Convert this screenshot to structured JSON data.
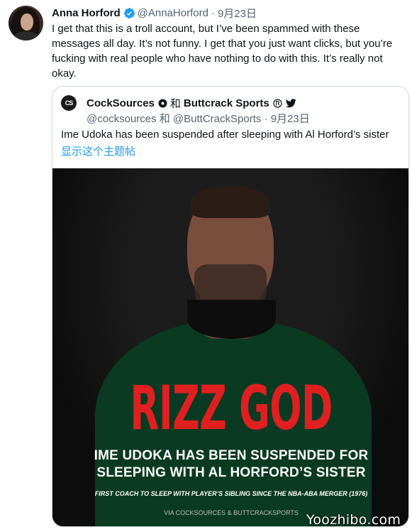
{
  "tweet": {
    "author_name": "Anna Horford",
    "handle": "@AnnaHorford",
    "separator": "·",
    "date": "9月23日",
    "text": "I get that this is a troll account, but I’ve been spammed with these messages all day. It’s not funny. I get that you just want clicks, but you’re fucking with real people who have nothing to do with this. It’s really not okay."
  },
  "quote": {
    "avatar_text": "CS",
    "author_name": "CockSources",
    "and": "和",
    "coauthor_name": "Buttcrack Sports",
    "handles": "@cocksources 和 @ButtCrackSports",
    "separator": "·",
    "date": "9月23日",
    "text": "Ime Udoka has been suspended after sleeping with Al Horford’s sister",
    "show_thread": "显示这个主题帖",
    "image": {
      "headline": "RIZZ GOD",
      "subline_1": "IME UDOKA HAS BEEN SUSPENDED FOR",
      "subline_2": "SLEEPING WITH AL HORFORD’S SISTER",
      "small_text": "FIRST COACH TO SLEEP WITH PLAYER’S SIBLING SINCE THE NBA-ABA MERGER (1976)",
      "credit": "VIA COCKSOURCES & BUTTCRACKSPORTS"
    }
  },
  "watermark": "Yoozhibo.com",
  "colors": {
    "verified": "#1d9bf0",
    "link": "#1d9bf0",
    "headline_red": "#e02020",
    "muted": "#536471"
  },
  "icons": [
    "verified-badge-icon",
    "circle-dot-icon",
    "registered-icon",
    "twitter-bird-icon"
  ]
}
